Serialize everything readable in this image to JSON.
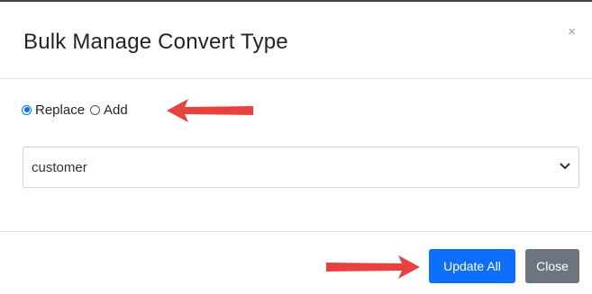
{
  "dialog": {
    "title": "Bulk Manage Convert Type",
    "close_glyph": "×"
  },
  "mode": {
    "options": [
      {
        "label": "Replace",
        "checked": true
      },
      {
        "label": "Add",
        "checked": false
      }
    ]
  },
  "convert_type_select": {
    "value": "customer"
  },
  "footer": {
    "update_all_label": "Update All",
    "close_label": "Close"
  },
  "colors": {
    "primary": "#0d6efd",
    "secondary": "#6c757d",
    "annotation_arrow": "#e8423f"
  },
  "annotations": {
    "arrow_icons": [
      "arrow-left-icon",
      "arrow-right-icon"
    ]
  }
}
